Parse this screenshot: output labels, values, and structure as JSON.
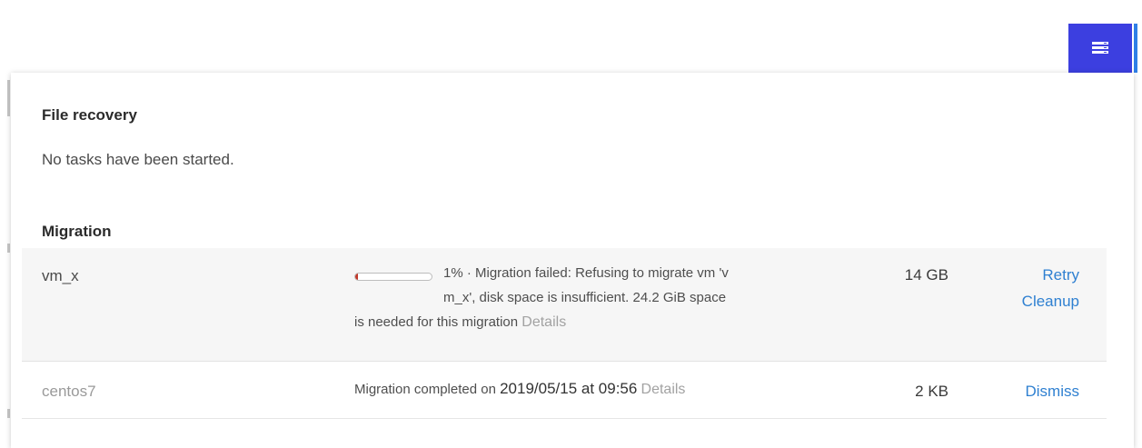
{
  "header": {
    "tasks_icon": "tasks-stack-icon",
    "accent_color": "#3c3fe0"
  },
  "file_recovery": {
    "title": "File recovery",
    "empty_message": "No tasks have been started."
  },
  "migration": {
    "title": "Migration",
    "tasks": [
      {
        "name": "vm_x",
        "progress_percent": 1,
        "status_line1": "1% · Migration failed: Refusing to migrate vm 'v",
        "status_line2": "m_x', disk space is insufficient. 24.2 GiB space",
        "status_line3": "is needed for this migration",
        "details_label": "Details",
        "size": "14 GB",
        "actions": [
          "Retry",
          "Cleanup"
        ],
        "progress_color": "#c0392b"
      },
      {
        "name": "centos7",
        "status_prefix": "Migration completed on",
        "completed_at": "2019/05/15 at 09:56",
        "details_label": "Details",
        "size": "2 KB",
        "actions": [
          "Dismiss"
        ]
      }
    ]
  },
  "colors": {
    "link": "#2f80d1",
    "muted": "#a2a2a2"
  }
}
